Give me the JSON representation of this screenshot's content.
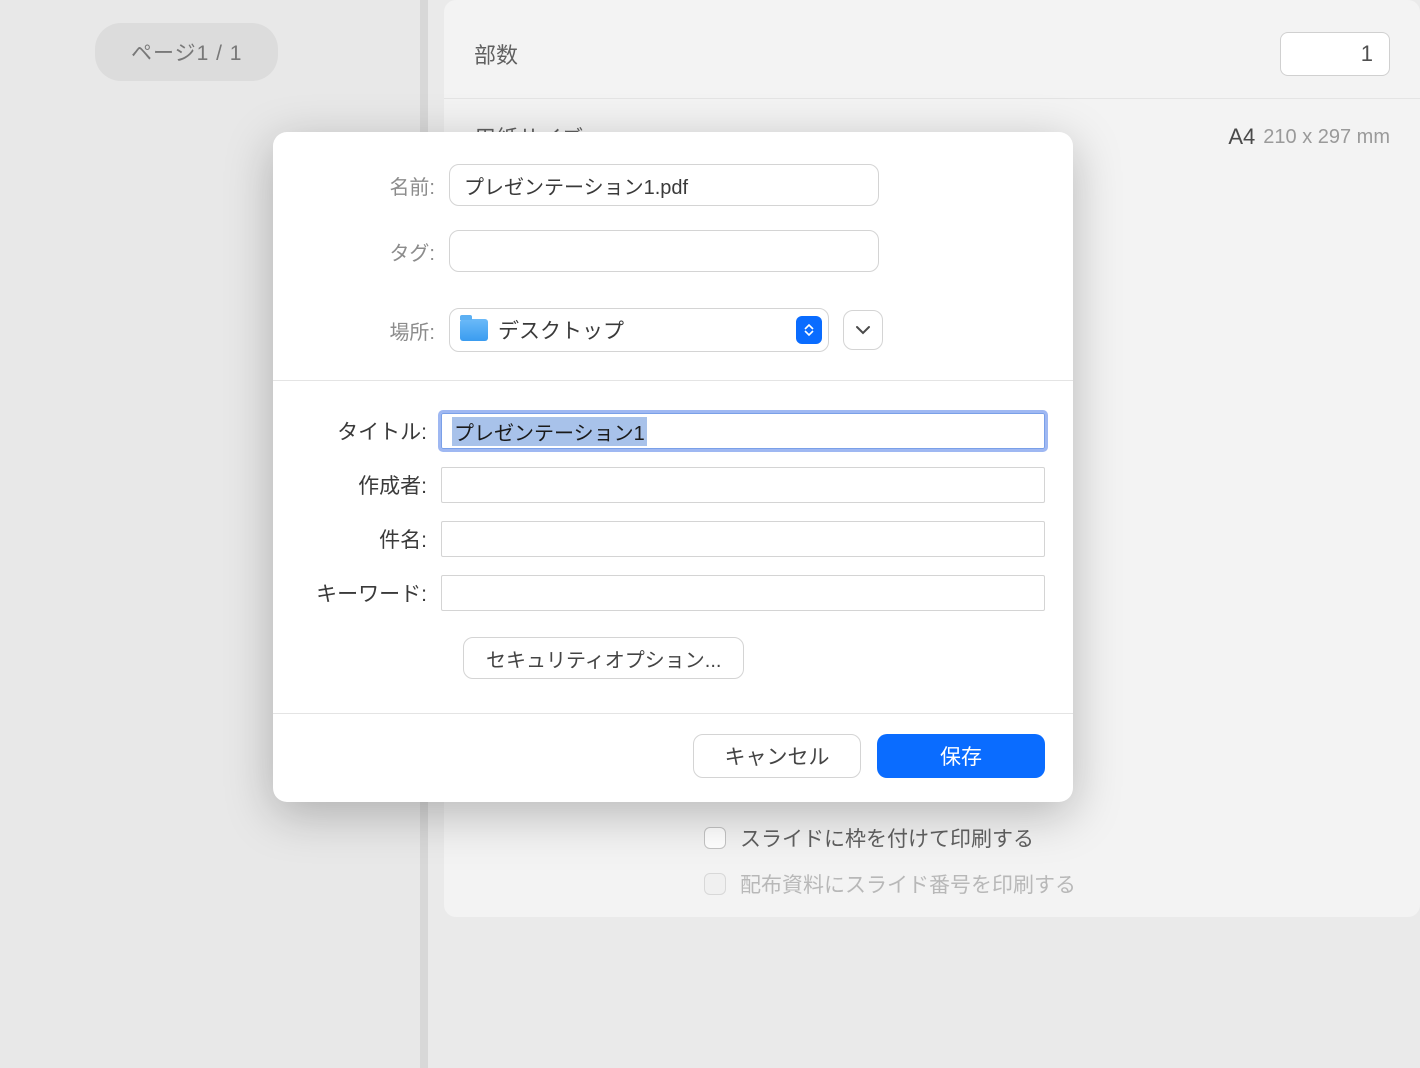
{
  "background": {
    "page_indicator": "ページ1 / 1",
    "print": {
      "copies_label": "部数",
      "copies_value": "1",
      "paper_label": "用紙サイズ",
      "paper_value": "A4",
      "paper_dim": "210 x 297 mm",
      "frame_option": "スライドに枠を付けて印刷する",
      "page_number_option": "配布資料にスライド番号を印刷する"
    }
  },
  "dialog": {
    "top": {
      "name_label": "名前:",
      "name_value": "プレゼンテーション1.pdf",
      "tag_label": "タグ:",
      "tag_value": "",
      "location_label": "場所:",
      "location_value": "デスクトップ"
    },
    "meta": {
      "title_label": "タイトル:",
      "title_value": "プレゼンテーション1",
      "author_label": "作成者:",
      "author_value": "",
      "subject_label": "件名:",
      "subject_value": "",
      "keywords_label": "キーワード:",
      "keywords_value": "",
      "security_button": "セキュリティオプション..."
    },
    "footer": {
      "cancel": "キャンセル",
      "save": "保存"
    }
  }
}
